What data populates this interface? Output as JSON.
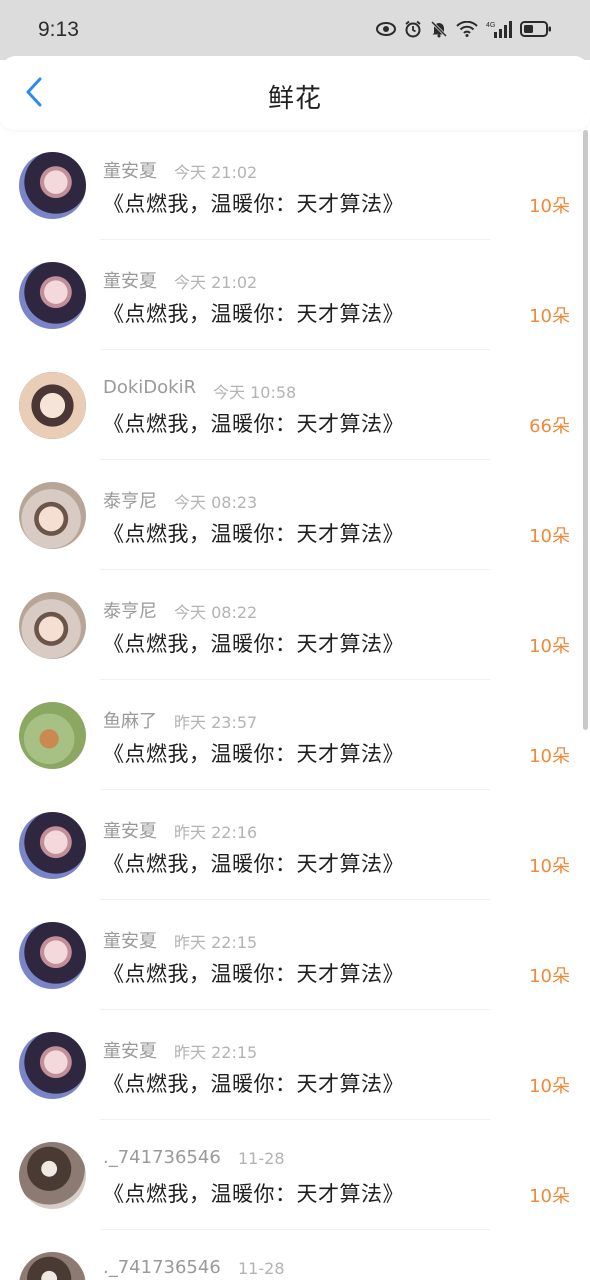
{
  "status_bar": {
    "time": "9:13",
    "icons": [
      "eye-icon",
      "alarm-icon",
      "mute-bell-icon",
      "wifi-icon",
      "signal-icon",
      "battery-icon"
    ],
    "network_label": "4G"
  },
  "header": {
    "title": "鲜花",
    "back_icon": "chevron-left-icon",
    "accent_color": "#2a8cf0"
  },
  "colors": {
    "count": "#f08a3a",
    "name": "#9a9a9a",
    "time": "#b3b3b3",
    "title": "#1f1f1f"
  },
  "items": [
    {
      "name": "童安夏",
      "time": "今天 21:02",
      "title": "《点燃我，温暖你：天才算法》",
      "count": "10朵",
      "avatar": "a-girl"
    },
    {
      "name": "童安夏",
      "time": "今天 21:02",
      "title": "《点燃我，温暖你：天才算法》",
      "count": "10朵",
      "avatar": "a-girl"
    },
    {
      "name": "DokiDokiR",
      "time": "今天 10:58",
      "title": "《点燃我，温暖你：天才算法》",
      "count": "66朵",
      "avatar": "a-doki"
    },
    {
      "name": "泰亨尼",
      "time": "今天 08:23",
      "title": "《点燃我，温暖你：天才算法》",
      "count": "10朵",
      "avatar": "a-tai"
    },
    {
      "name": "泰亨尼",
      "time": "今天 08:22",
      "title": "《点燃我，温暖你：天才算法》",
      "count": "10朵",
      "avatar": "a-tai"
    },
    {
      "name": "鱼麻了",
      "time": "昨天 23:57",
      "title": "《点燃我，温暖你：天才算法》",
      "count": "10朵",
      "avatar": "a-yu"
    },
    {
      "name": "童安夏",
      "time": "昨天 22:16",
      "title": "《点燃我，温暖你：天才算法》",
      "count": "10朵",
      "avatar": "a-girl"
    },
    {
      "name": "童安夏",
      "time": "昨天 22:15",
      "title": "《点燃我，温暖你：天才算法》",
      "count": "10朵",
      "avatar": "a-girl"
    },
    {
      "name": "童安夏",
      "time": "昨天 22:15",
      "title": "《点燃我，温暖你：天才算法》",
      "count": "10朵",
      "avatar": "a-girl"
    },
    {
      "name": "._741736546",
      "time": "11-28",
      "title": "《点燃我，温暖你：天才算法》",
      "count": "10朵",
      "avatar": "a-dark"
    },
    {
      "name": "._741736546",
      "time": "11-28",
      "title": "",
      "count": "",
      "avatar": "a-dark"
    }
  ]
}
